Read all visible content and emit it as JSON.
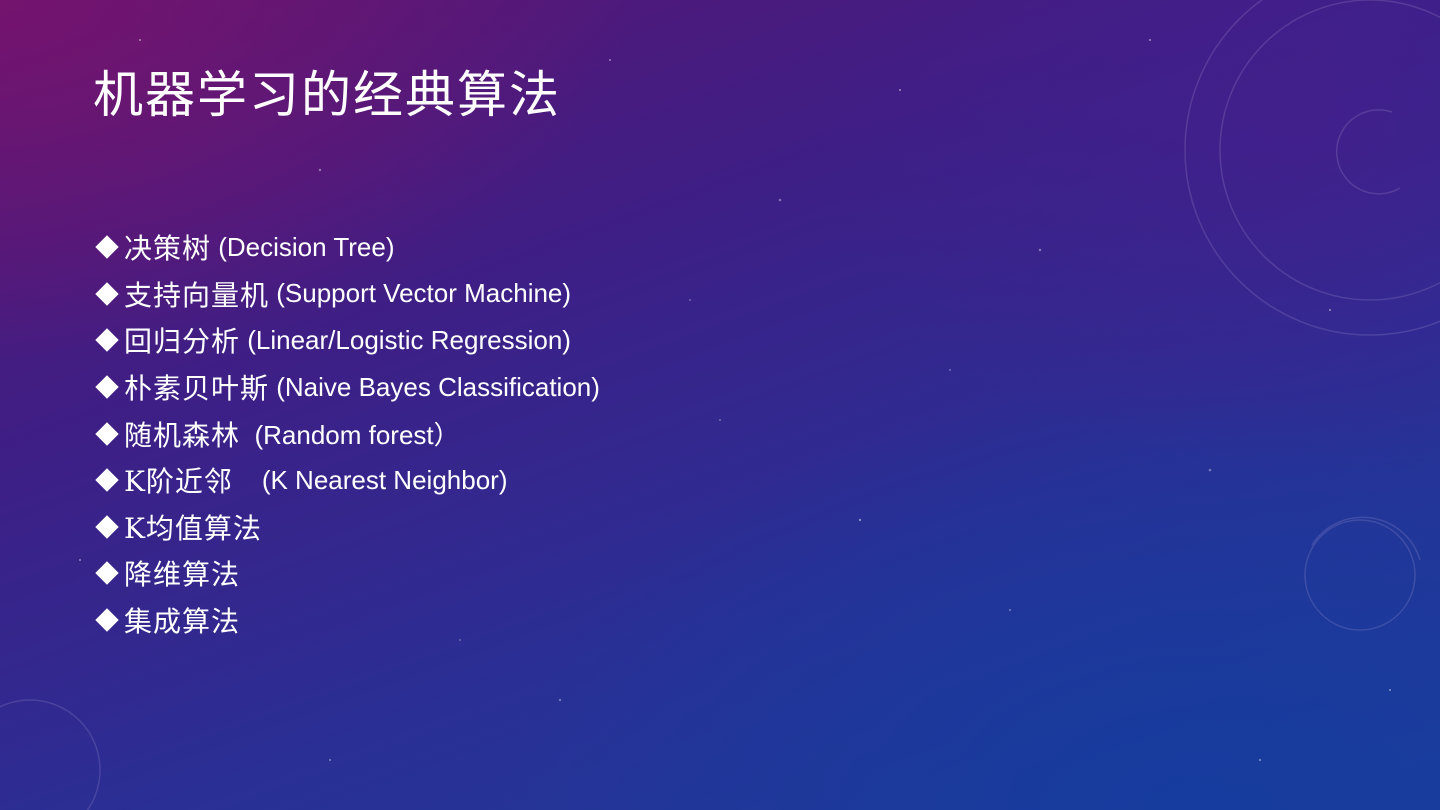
{
  "slide": {
    "title": "机器学习的经典算法",
    "items": [
      {
        "cn": "决策树",
        "en": " (Decision Tree)"
      },
      {
        "cn": "支持向量机",
        "en": " (Support Vector Machine)"
      },
      {
        "cn": "回归分析",
        "en": " (Linear/Logistic Regression)"
      },
      {
        "cn": "朴素贝叶斯",
        "en": " (Naive Bayes Classification)"
      },
      {
        "cn": "随机森林",
        "en": "  (Random forest）"
      },
      {
        "cn": "K阶近邻",
        "en": "    (K Nearest Neighbor)"
      },
      {
        "cn": "K均值算法",
        "en": ""
      },
      {
        "cn": "降维算法",
        "en": ""
      },
      {
        "cn": "集成算法",
        "en": ""
      }
    ],
    "bullet_icon": "diamond-icon"
  },
  "colors": {
    "text": "#ffffff",
    "background_top_left": "#5c1572",
    "background_bottom_right": "#1d3d9a"
  }
}
